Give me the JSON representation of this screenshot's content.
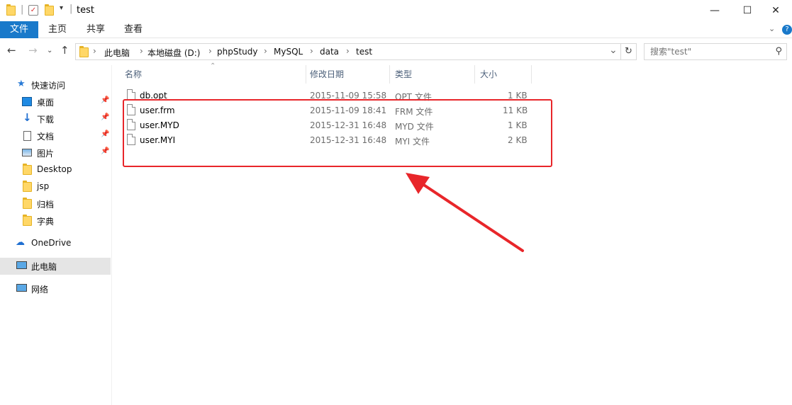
{
  "window": {
    "title": "test",
    "minimize": "—",
    "maximize": "☐",
    "close": "✕"
  },
  "ribbon": {
    "tabs": [
      "文件",
      "主页",
      "共享",
      "查看"
    ]
  },
  "address": {
    "crumbs": [
      "此电脑",
      "本地磁盘 (D:)",
      "phpStudy",
      "MySQL",
      "data",
      "test"
    ],
    "search_placeholder": "搜索\"test\""
  },
  "sidebar": {
    "quick_access": "快速访问",
    "items": [
      {
        "label": "桌面",
        "icon": "desktop-icon",
        "pinned": true
      },
      {
        "label": "下载",
        "icon": "download-icon",
        "pinned": true
      },
      {
        "label": "文档",
        "icon": "document-icon",
        "pinned": true
      },
      {
        "label": "图片",
        "icon": "picture-icon",
        "pinned": true
      },
      {
        "label": "Desktop",
        "icon": "folder-icon",
        "pinned": false
      },
      {
        "label": "jsp",
        "icon": "folder-icon",
        "pinned": false
      },
      {
        "label": "归档",
        "icon": "folder-icon",
        "pinned": false
      },
      {
        "label": "字典",
        "icon": "folder-icon",
        "pinned": false
      }
    ],
    "onedrive": "OneDrive",
    "this_pc": "此电脑",
    "network": "网络"
  },
  "columns": [
    "名称",
    "修改日期",
    "类型",
    "大小"
  ],
  "files": [
    {
      "name": "db.opt",
      "date": "2015-11-09 15:58",
      "type": "OPT 文件",
      "size": "1 KB"
    },
    {
      "name": "user.frm",
      "date": "2015-11-09 18:41",
      "type": "FRM 文件",
      "size": "11 KB"
    },
    {
      "name": "user.MYD",
      "date": "2015-12-31 16:48",
      "type": "MYD 文件",
      "size": "1 KB"
    },
    {
      "name": "user.MYI",
      "date": "2015-12-31 16:48",
      "type": "MYI 文件",
      "size": "2 KB"
    }
  ],
  "colors": {
    "accent": "#1979ca",
    "annotation": "#e8262a"
  }
}
